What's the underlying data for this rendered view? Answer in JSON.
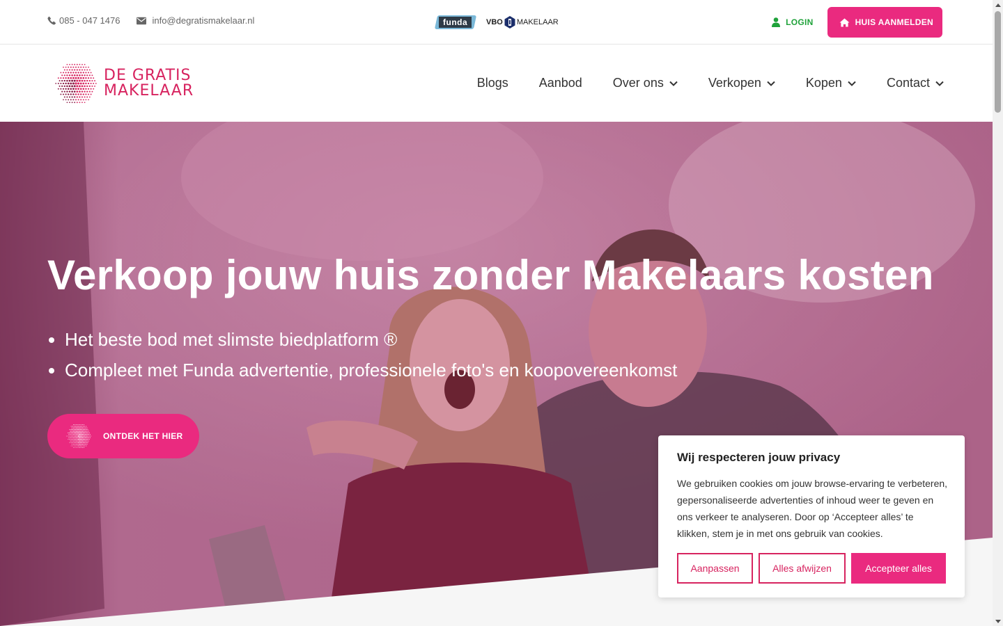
{
  "topbar": {
    "phone": "085 - 047 1476",
    "email": "info@degratismakelaar.nl",
    "funda_logo": "funda",
    "vbo_logo": {
      "vbo": "VBO",
      "makelaar": "MAKELAAR"
    },
    "login_label": "LOGIN",
    "cta_label": "HUIS AANMELDEN"
  },
  "header": {
    "logo_line1": "DE GRATIS",
    "logo_line2": "MAKELAAR",
    "nav": [
      {
        "label": "Blogs",
        "dropdown": false
      },
      {
        "label": "Aanbod",
        "dropdown": false
      },
      {
        "label": "Over ons",
        "dropdown": true
      },
      {
        "label": "Verkopen",
        "dropdown": true
      },
      {
        "label": "Kopen",
        "dropdown": true
      },
      {
        "label": "Contact",
        "dropdown": true
      }
    ]
  },
  "hero": {
    "title": "Verkoop jouw huis zonder Makelaars kosten",
    "bullets": [
      "Het beste bod met slimste biedplatform ®",
      "Compleet met  Funda advertentie, professionele foto's en koopovereenkomst"
    ],
    "button_label": "ONTDEK HET HIER"
  },
  "cookie": {
    "title": "Wij respecteren jouw privacy",
    "text": "We gebruiken cookies om jouw browse-ervaring te verbeteren, gepersonaliseerde advertenties of inhoud weer te geven en ons verkeer te analyseren. Door op ‘Accepteer alles’ te klikken, stem je in met ons gebruik van cookies.",
    "customize_label": "Aanpassen",
    "reject_label": "Alles afwijzen",
    "accept_label": "Accepteer alles"
  },
  "colors": {
    "brand_pink": "#ea2a7f",
    "logo_pink": "#d7235f",
    "login_green": "#1fa23a",
    "hero_overlay": "#b26a8f"
  },
  "icons": [
    "phone-icon",
    "envelope-icon",
    "user-icon",
    "home-icon",
    "chevron-down-icon",
    "logo-dots-icon",
    "scroll-up-icon",
    "scroll-down-icon"
  ]
}
